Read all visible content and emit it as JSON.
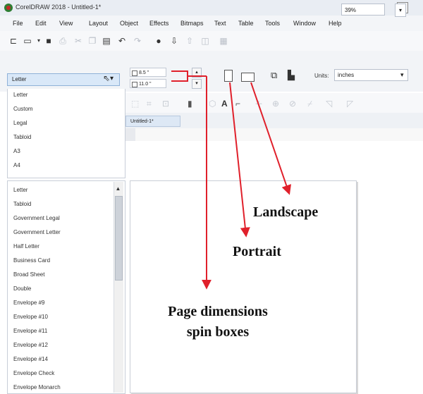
{
  "window": {
    "title": "CorelDRAW 2018 - Untitled-1*"
  },
  "menu": [
    "File",
    "Edit",
    "View",
    "Layout",
    "Object",
    "Effects",
    "Bitmaps",
    "Text",
    "Table",
    "Tools",
    "Window",
    "Help"
  ],
  "toolbar": {
    "zoom": "39%"
  },
  "propertybar": {
    "page_size": "Letter",
    "width": "8.5 \"",
    "height": "11.0 \"",
    "units_label": "Units:",
    "units": "inches"
  },
  "document": {
    "tab": "Untitled-1*"
  },
  "page_size_list_top": [
    "Letter",
    "Custom",
    "Legal",
    "Tabloid",
    "A3",
    "A4"
  ],
  "page_size_list": [
    "Letter",
    "Tabloid",
    "Government Legal",
    "Government Letter",
    "Half Letter",
    "Business Card",
    "Broad Sheet",
    "Double",
    "Envelope #9",
    "Envelope #10",
    "Envelope #11",
    "Envelope #12",
    "Envelope #14",
    "Envelope Check",
    "Envelope Monarch"
  ],
  "annotations": {
    "landscape": "Landscape",
    "portrait": "Portrait",
    "dims_line1": "Page dimensions",
    "dims_line2": "spin boxes"
  },
  "colors": {
    "arrow": "#e0202b",
    "selection": "#d9e8f8"
  }
}
